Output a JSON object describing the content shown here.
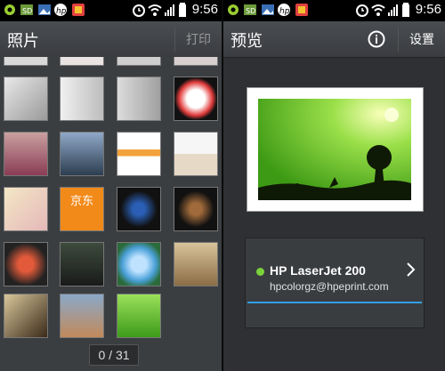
{
  "left": {
    "status": {
      "time": "9:56"
    },
    "title": "照片",
    "print_button": "打印",
    "page_indicator": "0 / 31",
    "thumb_texts": {
      "jd": "京东"
    }
  },
  "right": {
    "status": {
      "time": "9:56"
    },
    "title": "预览",
    "settings_button": "设置",
    "printer": {
      "name": "HP LaserJet 200",
      "email": "hpcolorgz@hpeprint.com"
    }
  },
  "colors": {
    "accent_blue": "#33a0e6",
    "printer_online": "#7bd33a",
    "preview_green": "#4db81e"
  },
  "icons": [
    "gps-icon",
    "sd-card-icon",
    "image-icon",
    "hp-logo-icon",
    "app-icon",
    "alarm-icon",
    "wifi-icon",
    "signal-icon",
    "battery-icon",
    "info-icon",
    "chevron-right-icon"
  ]
}
